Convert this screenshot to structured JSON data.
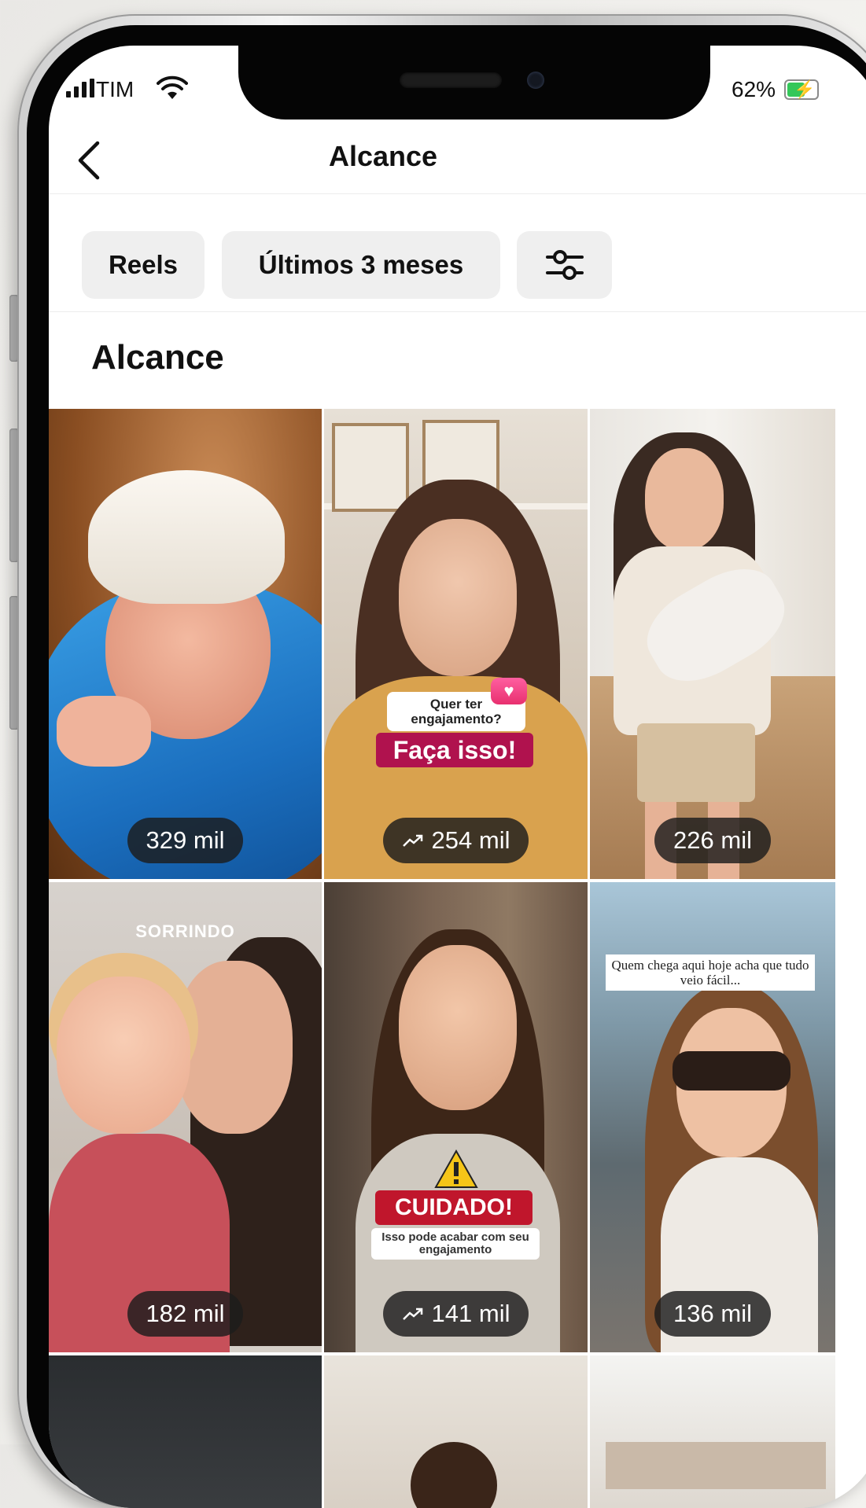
{
  "status_bar": {
    "carrier": "TIM",
    "battery_percent": "62%",
    "battery_level": 0.62,
    "battery_color": "#34c759"
  },
  "header": {
    "title": "Alcance",
    "back_icon": "chevron-left-icon"
  },
  "filters": {
    "content_type": "Reels",
    "period": "Últimos 3 meses",
    "settings_icon": "sliders-icon"
  },
  "section": {
    "title": "Alcance"
  },
  "grid": [
    {
      "reach": "329 mil",
      "trending": false,
      "overlay": null
    },
    {
      "reach": "254 mil",
      "trending": true,
      "overlay": {
        "question": "Quer ter engajamento?",
        "headline": "Faça isso!"
      }
    },
    {
      "reach": "226 mil",
      "trending": false,
      "overlay": null
    },
    {
      "reach": "182 mil",
      "trending": false,
      "overlay": {
        "caption": "SORRINDO"
      }
    },
    {
      "reach": "141 mil",
      "trending": true,
      "overlay": {
        "headline": "CUIDADO!",
        "subtext": "Isso pode acabar com seu engajamento"
      }
    },
    {
      "reach": "136 mil",
      "trending": false,
      "overlay": {
        "caption": "Quem chega aqui hoje acha que tudo veio fácil..."
      }
    }
  ],
  "colors": {
    "chip_bg": "#efefef",
    "text": "#111111",
    "pill_bg": "#1c1c1c",
    "accent_magenta": "#b0124e"
  }
}
